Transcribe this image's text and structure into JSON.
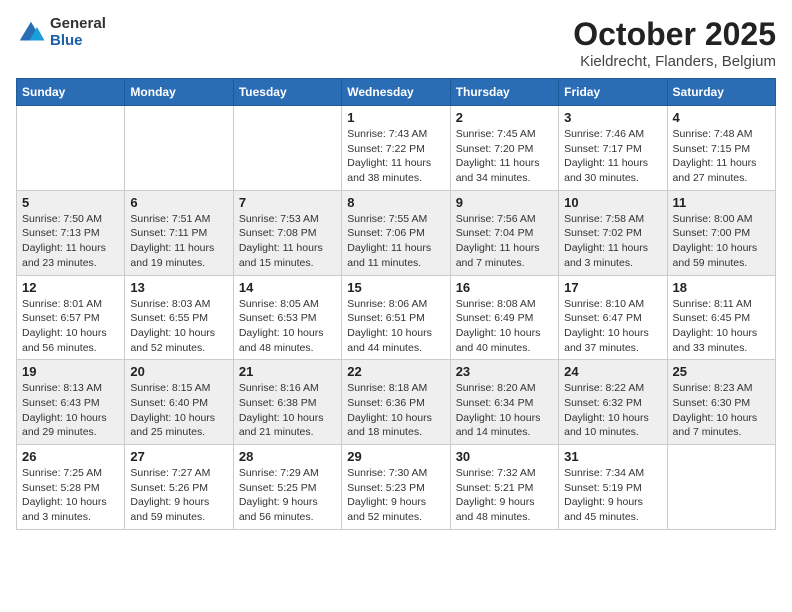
{
  "header": {
    "logo": {
      "general": "General",
      "blue": "Blue"
    },
    "title": "October 2025",
    "subtitle": "Kieldrecht, Flanders, Belgium"
  },
  "days_of_week": [
    "Sunday",
    "Monday",
    "Tuesday",
    "Wednesday",
    "Thursday",
    "Friday",
    "Saturday"
  ],
  "weeks": [
    [
      {
        "day": "",
        "info": ""
      },
      {
        "day": "",
        "info": ""
      },
      {
        "day": "",
        "info": ""
      },
      {
        "day": "1",
        "info": "Sunrise: 7:43 AM\nSunset: 7:22 PM\nDaylight: 11 hours\nand 38 minutes."
      },
      {
        "day": "2",
        "info": "Sunrise: 7:45 AM\nSunset: 7:20 PM\nDaylight: 11 hours\nand 34 minutes."
      },
      {
        "day": "3",
        "info": "Sunrise: 7:46 AM\nSunset: 7:17 PM\nDaylight: 11 hours\nand 30 minutes."
      },
      {
        "day": "4",
        "info": "Sunrise: 7:48 AM\nSunset: 7:15 PM\nDaylight: 11 hours\nand 27 minutes."
      }
    ],
    [
      {
        "day": "5",
        "info": "Sunrise: 7:50 AM\nSunset: 7:13 PM\nDaylight: 11 hours\nand 23 minutes."
      },
      {
        "day": "6",
        "info": "Sunrise: 7:51 AM\nSunset: 7:11 PM\nDaylight: 11 hours\nand 19 minutes."
      },
      {
        "day": "7",
        "info": "Sunrise: 7:53 AM\nSunset: 7:08 PM\nDaylight: 11 hours\nand 15 minutes."
      },
      {
        "day": "8",
        "info": "Sunrise: 7:55 AM\nSunset: 7:06 PM\nDaylight: 11 hours\nand 11 minutes."
      },
      {
        "day": "9",
        "info": "Sunrise: 7:56 AM\nSunset: 7:04 PM\nDaylight: 11 hours\nand 7 minutes."
      },
      {
        "day": "10",
        "info": "Sunrise: 7:58 AM\nSunset: 7:02 PM\nDaylight: 11 hours\nand 3 minutes."
      },
      {
        "day": "11",
        "info": "Sunrise: 8:00 AM\nSunset: 7:00 PM\nDaylight: 10 hours\nand 59 minutes."
      }
    ],
    [
      {
        "day": "12",
        "info": "Sunrise: 8:01 AM\nSunset: 6:57 PM\nDaylight: 10 hours\nand 56 minutes."
      },
      {
        "day": "13",
        "info": "Sunrise: 8:03 AM\nSunset: 6:55 PM\nDaylight: 10 hours\nand 52 minutes."
      },
      {
        "day": "14",
        "info": "Sunrise: 8:05 AM\nSunset: 6:53 PM\nDaylight: 10 hours\nand 48 minutes."
      },
      {
        "day": "15",
        "info": "Sunrise: 8:06 AM\nSunset: 6:51 PM\nDaylight: 10 hours\nand 44 minutes."
      },
      {
        "day": "16",
        "info": "Sunrise: 8:08 AM\nSunset: 6:49 PM\nDaylight: 10 hours\nand 40 minutes."
      },
      {
        "day": "17",
        "info": "Sunrise: 8:10 AM\nSunset: 6:47 PM\nDaylight: 10 hours\nand 37 minutes."
      },
      {
        "day": "18",
        "info": "Sunrise: 8:11 AM\nSunset: 6:45 PM\nDaylight: 10 hours\nand 33 minutes."
      }
    ],
    [
      {
        "day": "19",
        "info": "Sunrise: 8:13 AM\nSunset: 6:43 PM\nDaylight: 10 hours\nand 29 minutes."
      },
      {
        "day": "20",
        "info": "Sunrise: 8:15 AM\nSunset: 6:40 PM\nDaylight: 10 hours\nand 25 minutes."
      },
      {
        "day": "21",
        "info": "Sunrise: 8:16 AM\nSunset: 6:38 PM\nDaylight: 10 hours\nand 21 minutes."
      },
      {
        "day": "22",
        "info": "Sunrise: 8:18 AM\nSunset: 6:36 PM\nDaylight: 10 hours\nand 18 minutes."
      },
      {
        "day": "23",
        "info": "Sunrise: 8:20 AM\nSunset: 6:34 PM\nDaylight: 10 hours\nand 14 minutes."
      },
      {
        "day": "24",
        "info": "Sunrise: 8:22 AM\nSunset: 6:32 PM\nDaylight: 10 hours\nand 10 minutes."
      },
      {
        "day": "25",
        "info": "Sunrise: 8:23 AM\nSunset: 6:30 PM\nDaylight: 10 hours\nand 7 minutes."
      }
    ],
    [
      {
        "day": "26",
        "info": "Sunrise: 7:25 AM\nSunset: 5:28 PM\nDaylight: 10 hours\nand 3 minutes."
      },
      {
        "day": "27",
        "info": "Sunrise: 7:27 AM\nSunset: 5:26 PM\nDaylight: 9 hours\nand 59 minutes."
      },
      {
        "day": "28",
        "info": "Sunrise: 7:29 AM\nSunset: 5:25 PM\nDaylight: 9 hours\nand 56 minutes."
      },
      {
        "day": "29",
        "info": "Sunrise: 7:30 AM\nSunset: 5:23 PM\nDaylight: 9 hours\nand 52 minutes."
      },
      {
        "day": "30",
        "info": "Sunrise: 7:32 AM\nSunset: 5:21 PM\nDaylight: 9 hours\nand 48 minutes."
      },
      {
        "day": "31",
        "info": "Sunrise: 7:34 AM\nSunset: 5:19 PM\nDaylight: 9 hours\nand 45 minutes."
      },
      {
        "day": "",
        "info": ""
      }
    ]
  ]
}
